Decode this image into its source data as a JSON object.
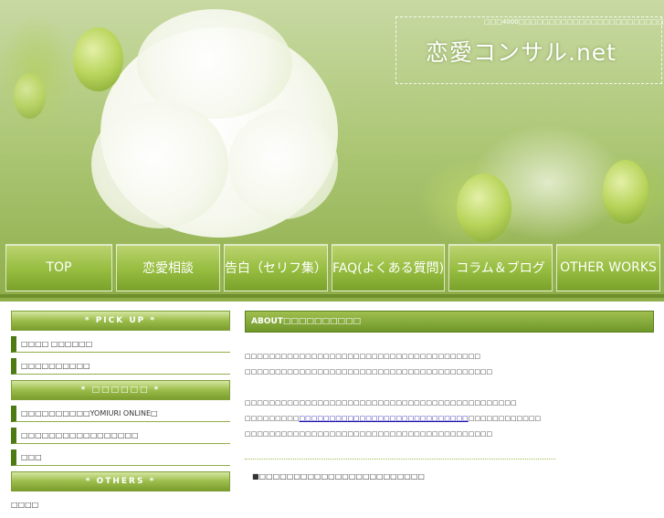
{
  "header": {
    "tagline": "□□□4000□□□□□□□□□□□□□□□□□□□□□□□□□□□□□□□□□",
    "site_title": "恋愛コンサル.net"
  },
  "nav": {
    "items": [
      "TOP",
      "恋愛相談",
      "告白（セリフ集）",
      "FAQ(よくある質問)",
      "コラム＆ブログ",
      "OTHER WORKS"
    ]
  },
  "sidebar": {
    "pickup_heading": "* PICK UP *",
    "pickup_items": [
      "□□□□ □□□□□□",
      "□□□□□□□□□□"
    ],
    "section2_heading": "* □□□□□□ *",
    "section2_items": [
      "□□□□□□□□□□YOMIURI ONLINE□",
      "□□□□□□□□□□□□□□□□□",
      "□□□"
    ],
    "others_heading": "* OTHERS *",
    "others_items": [
      "□□□□"
    ]
  },
  "main": {
    "heading": "ABOUT□□□□□□□□□□",
    "para1_line1": "□□□□□□□□□□□□□□□□□□□□□□□□□□□□□□□□□□□□□□□",
    "para1_line2": "□□□□□□□□□□□□□□□□□□□□□□□□□□□□□□□□□□□□□□□□□",
    "para2_line1": "□□□□□□□□□□□□□□□□□□□□□□□□□□□□□□□□□□□□□□□□□□□□□",
    "para2_line2_pre": "□□□□□□□□□",
    "para2_link": "□□□□□□□□□□□□□□□□□□□□□□□□□□□□",
    "para2_line2_post": "□□□□□□□□□□□□",
    "para2_line3": "□□□□□□□□□□□□□□□□□□□□□□□□□□□□□□□□□□□□□□□□□",
    "section_title": "■□□□□□□□□□□□□□□□□□□□□□□□□"
  },
  "colors": {
    "accent": "#6f972a",
    "nav_green": "#9bbd4b",
    "link": "#1a0dab"
  }
}
